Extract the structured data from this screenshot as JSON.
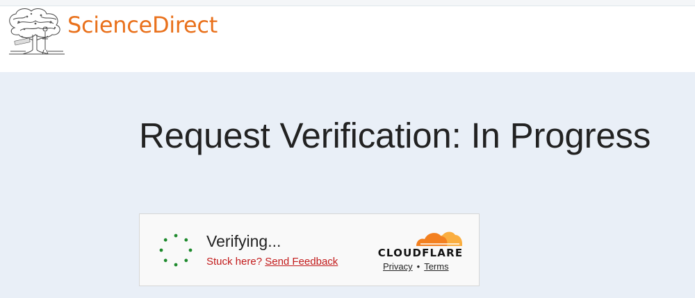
{
  "header": {
    "brand": "ScienceDirect",
    "logo_icon": "elsevier-tree-icon",
    "brand_color": "#e9711c"
  },
  "main": {
    "title": "Request Verification: In Progress"
  },
  "challenge": {
    "status": "Verifying...",
    "stuck_prefix": "Stuck here?",
    "feedback_link": "Send Feedback",
    "spinner_icon": "loading-spinner-icon",
    "spinner_color": "#1e8a2d",
    "error_color": "#c21a1a",
    "provider": {
      "logo_icon": "cloudflare-cloud-icon",
      "wordmark": "CLOUDFLARE",
      "cloud_colors": [
        "#f38020",
        "#faae40"
      ],
      "privacy_link": "Privacy",
      "separator": "•",
      "terms_link": "Terms"
    }
  }
}
